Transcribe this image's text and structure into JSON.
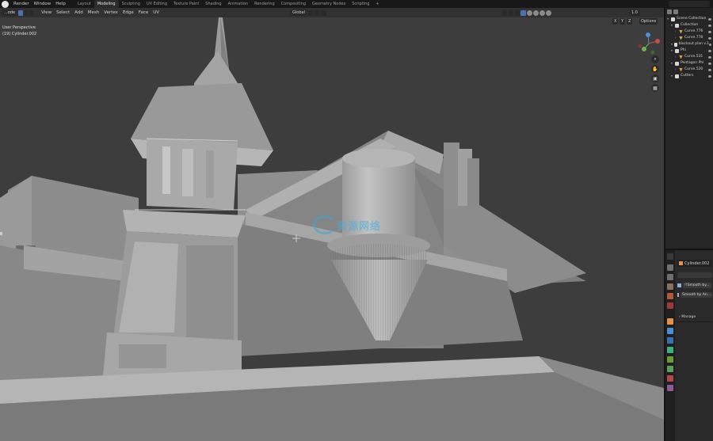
{
  "topbar": {
    "menus": [
      "Render",
      "Window",
      "Help"
    ],
    "workspaces": [
      "Layout",
      "Modeling",
      "Sculpting",
      "UV Editing",
      "Texture Paint",
      "Shading",
      "Animation",
      "Rendering",
      "Compositing",
      "Geometry Nodes",
      "Scripting"
    ],
    "active_workspace": "Modeling",
    "add_tab": "+"
  },
  "viewport": {
    "mode": "...ode",
    "menus": [
      "View",
      "Select",
      "Add",
      "Mesh",
      "Vertex",
      "Edge",
      "Face",
      "UV"
    ],
    "orientation": "Global",
    "snap_value": "1.0",
    "options_label": "Options",
    "axis_labels": [
      "X",
      "Y",
      "Z"
    ],
    "perspective_label": "User Perspective",
    "object_info": "(19) Cylinder.002"
  },
  "watermark": {
    "text": "资源网络"
  },
  "outliner": {
    "items": [
      {
        "label": "Scene Collection",
        "level": 0,
        "icon": "collection-icon"
      },
      {
        "label": "Collection",
        "level": 1,
        "icon": "collection-icon"
      },
      {
        "label": "Curve.776",
        "level": 2,
        "icon": "curve-icon"
      },
      {
        "label": "Curve.778",
        "level": 2,
        "icon": "curve-icon"
      },
      {
        "label": "blockout plan v.1",
        "level": 1,
        "icon": "collection-icon"
      },
      {
        "label": "Phi",
        "level": 1,
        "icon": "collection-icon"
      },
      {
        "label": "Curve.531",
        "level": 2,
        "icon": "curve-icon"
      },
      {
        "label": "Pentagon Phi",
        "level": 1,
        "icon": "collection-icon"
      },
      {
        "label": "Curve.520",
        "level": 2,
        "icon": "curve-icon"
      },
      {
        "label": "Cutters",
        "level": 1,
        "icon": "collection-icon"
      }
    ]
  },
  "properties": {
    "object_name": "Cylinder.002",
    "modifier_name": "!!Smooth by...",
    "modifier_type": "Smooth by An...",
    "manage_label": "Manage"
  },
  "colors": {
    "accent": "#4772b3",
    "viewport_bg": "#3d3d3d",
    "curve_icon": "#e29f4a",
    "watermark": "#3fb0e0"
  }
}
